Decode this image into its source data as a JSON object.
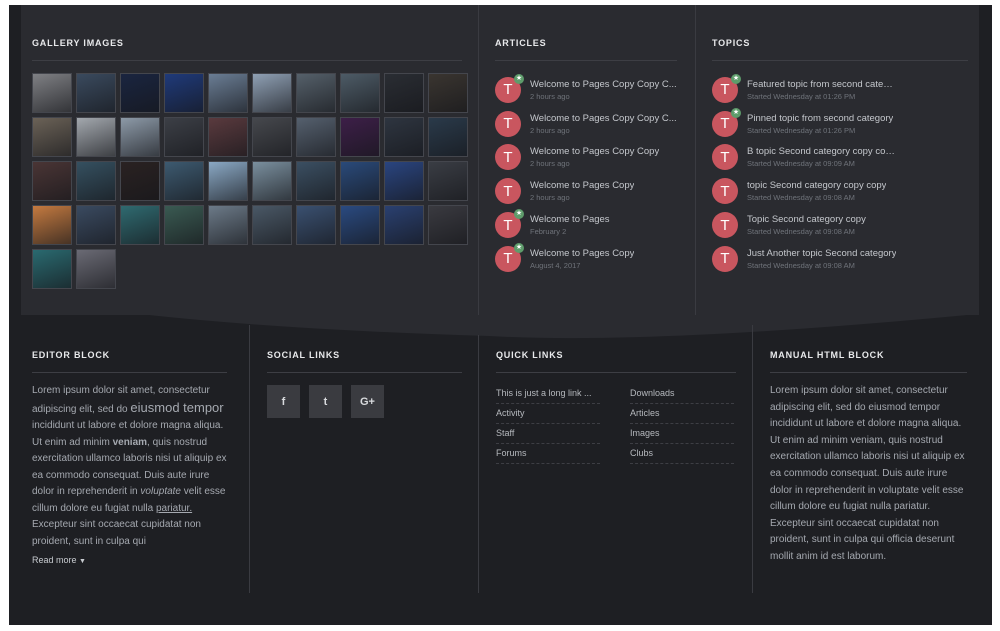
{
  "gallery": {
    "title": "GALLERY IMAGES",
    "thumbs": [
      "#7f8084",
      "#3a4a5e",
      "#1a2540",
      "#1f3a7a",
      "#6a7d94",
      "#8fa0b4",
      "#55606a",
      "#4d5b66",
      "#2a2d33",
      "#3a3530",
      "#6b6257",
      "#a3a8ae",
      "#8d9aa8",
      "#3c3f46",
      "#5a3a3e",
      "#46484d",
      "#55606e",
      "#3d1f48",
      "#2e3540",
      "#2a3a4a",
      "#4a3535",
      "#355060",
      "#2a2222",
      "#3d5a70",
      "#8aa8c4",
      "#7a8f9e",
      "#3b4f62",
      "#2a4a7a",
      "#2a4580",
      "#3a3d44",
      "#c47a40",
      "#3a4a60",
      "#2f6a70",
      "#3a5a52",
      "#6c7a88",
      "#4a5866",
      "#3a5070",
      "#2a4a80",
      "#2a4070",
      "#3a3a40",
      "#2a6a70",
      "#6a6a74"
    ]
  },
  "articles": {
    "title": "ARTICLES",
    "items": [
      {
        "initial": "T",
        "star": true,
        "title": "Welcome to Pages Copy Copy C...",
        "meta": "2 hours ago"
      },
      {
        "initial": "T",
        "star": false,
        "title": "Welcome to Pages Copy Copy C...",
        "meta": "2 hours ago"
      },
      {
        "initial": "T",
        "star": false,
        "title": "Welcome to Pages Copy Copy",
        "meta": "2 hours ago"
      },
      {
        "initial": "T",
        "star": false,
        "title": "Welcome to Pages Copy",
        "meta": "2 hours ago"
      },
      {
        "initial": "T",
        "star": true,
        "title": "Welcome to Pages",
        "meta": "February 2"
      },
      {
        "initial": "T",
        "star": true,
        "title": "Welcome to Pages Copy",
        "meta": "August 4, 2017"
      }
    ]
  },
  "topics": {
    "title": "TOPICS",
    "items": [
      {
        "initial": "T",
        "star": true,
        "title": "Featured topic from second category",
        "meta": "Started Wednesday at 01:26 PM"
      },
      {
        "initial": "T",
        "star": true,
        "title": "Pinned topic from second category",
        "meta": "Started Wednesday at 01:26 PM"
      },
      {
        "initial": "T",
        "star": false,
        "title": "B topic Second category copy copy copy",
        "meta": "Started Wednesday at 09:09 AM"
      },
      {
        "initial": "T",
        "star": false,
        "title": "topic Second category copy copy",
        "meta": "Started Wednesday at 09:08 AM"
      },
      {
        "initial": "T",
        "star": false,
        "title": "Topic Second category copy",
        "meta": "Started Wednesday at 09:08 AM"
      },
      {
        "initial": "T",
        "star": false,
        "title": "Just Another topic Second category",
        "meta": "Started Wednesday at 09:08 AM"
      }
    ]
  },
  "editor": {
    "title": "EDITOR BLOCK",
    "p1": "Lorem ipsum dolor sit amet, consectetur adipiscing elit, sed do ",
    "big": "eiusmod tempor",
    "p2": " incididunt ut labore et dolore magna aliqua. Ut enim ad minim ",
    "bold": "veniam",
    "p3": ", quis nostrud exercitation ullamco laboris nisi ut aliquip ex ea commodo consequat. Duis aute irure dolor in reprehenderit in ",
    "italic": "voluptate",
    "p4": " velit esse cillum dolore eu fugiat nulla ",
    "link": "pariatur.",
    "p5": " Excepteur sint occaecat cupidatat non proident, sunt in culpa qui",
    "read_more": "Read more"
  },
  "social": {
    "title": "SOCIAL LINKS",
    "buttons": [
      {
        "icon": "facebook-icon",
        "glyph": "f"
      },
      {
        "icon": "twitter-icon",
        "glyph": "t"
      },
      {
        "icon": "google-plus-icon",
        "glyph": "G+"
      }
    ]
  },
  "quick": {
    "title": "QUICK LINKS",
    "left": [
      "This is just a long link ...",
      "Activity",
      "Staff",
      "Forums"
    ],
    "right": [
      "Downloads",
      "Articles",
      "Images",
      "Clubs"
    ]
  },
  "manual": {
    "title": "MANUAL HTML BLOCK",
    "text": "Lorem ipsum dolor sit amet, consectetur adipiscing elit, sed do eiusmod tempor incididunt ut labore et dolore magna aliqua. Ut enim ad minim veniam, quis nostrud exercitation ullamco laboris nisi ut aliquip ex ea commodo consequat. Duis aute irure dolor in reprehenderit in voluptate velit esse cillum dolore eu fugiat nulla pariatur. Excepteur sint occaecat cupidatat non proident, sunt in culpa qui officia deserunt mollit anim id est laborum."
  },
  "colors": {
    "background": "#1e1f23",
    "panel": "#2a2b30",
    "avatar": "#c9565f",
    "star_badge": "#5e9c6b"
  }
}
